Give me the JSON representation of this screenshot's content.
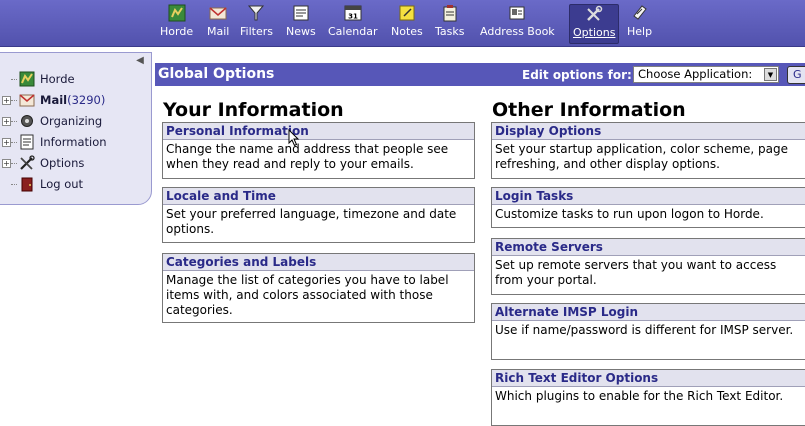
{
  "nav": {
    "items": [
      {
        "label": "Horde",
        "icon": "horde-icon"
      },
      {
        "label": "Mail",
        "icon": "mail-icon"
      },
      {
        "label": "Filters",
        "icon": "filter-icon"
      },
      {
        "label": "News",
        "icon": "news-icon"
      },
      {
        "label": "Calendar",
        "icon": "calendar-icon"
      },
      {
        "label": "Notes",
        "icon": "notes-icon"
      },
      {
        "label": "Tasks",
        "icon": "tasks-icon"
      },
      {
        "label": "Address Book",
        "icon": "address-book-icon"
      },
      {
        "label": "Options",
        "icon": "options-icon"
      },
      {
        "label": "Help",
        "icon": "help-icon"
      }
    ],
    "calendar_day": "31",
    "active": "Options"
  },
  "sidebar": {
    "items": [
      {
        "label": "Horde",
        "count": "",
        "icon": "horde-icon"
      },
      {
        "label": "Mail",
        "count": " (3290)",
        "icon": "mail-icon"
      },
      {
        "label": "Organizing",
        "count": "",
        "icon": "organizing-icon"
      },
      {
        "label": "Information",
        "count": "",
        "icon": "information-icon"
      },
      {
        "label": "Options",
        "count": "",
        "icon": "options-icon"
      },
      {
        "label": "Log out",
        "count": "",
        "icon": "logout-icon"
      }
    ]
  },
  "header": {
    "title": "Global Options",
    "edit_label": "Edit options for:",
    "select_value": "Choose Application:",
    "go_label": "G"
  },
  "left_column": {
    "title": "Your Information",
    "options": [
      {
        "title": "Personal Information",
        "description": "Change the name and address that people see when they read and reply to your emails."
      },
      {
        "title": "Locale and Time",
        "description": "Set your preferred language, timezone and date options."
      },
      {
        "title": "Categories and Labels",
        "description": "Manage the list of categories you have to label items with, and colors associated with those categories."
      }
    ]
  },
  "right_column": {
    "title": "Other Information",
    "options": [
      {
        "title": "Display Options",
        "description": "Set your startup application, color scheme, page refreshing, and other display options."
      },
      {
        "title": "Login Tasks",
        "description": "Customize tasks to run upon logon to Horde."
      },
      {
        "title": "Remote Servers",
        "description": "Set up remote servers that you want to access from your portal."
      },
      {
        "title": "Alternate IMSP Login",
        "description": "Use if name/password is different for IMSP server."
      },
      {
        "title": "Rich Text Editor Options",
        "description": "Which plugins to enable for the Rich Text Editor."
      }
    ]
  },
  "colors": {
    "topbar": "#5a5ab4",
    "header": "#5757b8",
    "option_title": "#2a2a88",
    "sidebar_bg": "#e6e6f4"
  }
}
